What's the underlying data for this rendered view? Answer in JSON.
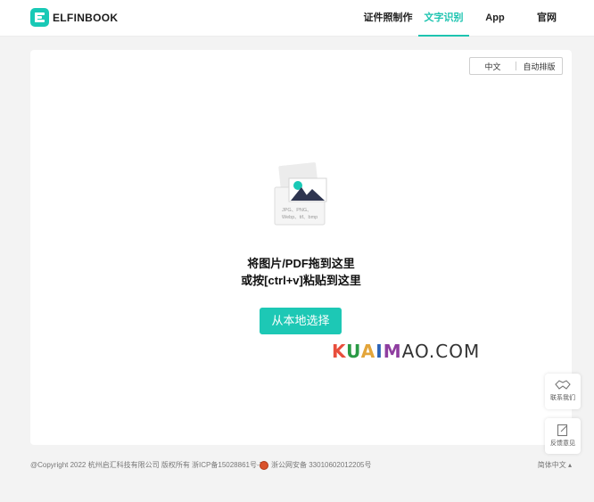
{
  "brand": {
    "name": "ELFINBOOK",
    "accent": "#1dc8b5"
  },
  "nav": {
    "items": [
      {
        "label": "证件照制作",
        "active": false
      },
      {
        "label": "文字识别",
        "active": true
      },
      {
        "label": "App",
        "active": false
      },
      {
        "label": "官网",
        "active": false
      }
    ]
  },
  "toolbar": {
    "lang_option": "中文",
    "layout_option": "自动排版"
  },
  "upload": {
    "formats_line1": "JPG、PNG、",
    "formats_line2": "Webp、tif、bmp",
    "drop_line1": "将图片/PDF拖到这里",
    "drop_line2": "或按[ctrl+v]粘贴到这里",
    "choose_label": "从本地选择"
  },
  "watermark": {
    "k": "K",
    "u": "U",
    "a": "A",
    "i": "I",
    "m": "M",
    "rest": "AO.COM"
  },
  "side": {
    "contact_label": "联系我们",
    "feedback_label": "反馈意见"
  },
  "footer": {
    "copyright": "@Copyright 2022 杭州启汇科技有限公司 版权所有 浙ICP备15028861号-7",
    "police": "浙公网安备 33010602012205号",
    "language": "简体中文"
  }
}
